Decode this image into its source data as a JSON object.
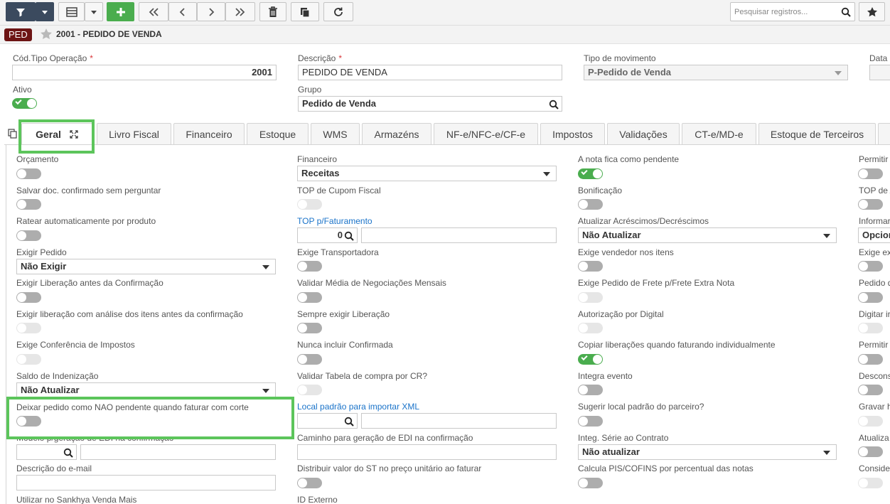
{
  "toolbar": {
    "search_placeholder": "Pesquisar registros..."
  },
  "header": {
    "badge": "PED",
    "title": "2001 - PEDIDO DE VENDA"
  },
  "form": {
    "cod_tipo_label": "Cód.Tipo Operação",
    "cod_tipo_value": "2001",
    "descricao_label": "Descrição",
    "descricao_value": "PEDIDO DE VENDA",
    "tipo_mov_label": "Tipo de movimento",
    "tipo_mov_value": "P-Pedido de Venda",
    "data_label": "Data",
    "ativo_label": "Ativo",
    "grupo_label": "Grupo",
    "grupo_value": "Pedido de Venda",
    "required_mark": "*"
  },
  "tabs": [
    "Geral",
    "Livro Fiscal",
    "Financeiro",
    "Estoque",
    "WMS",
    "Armazéns",
    "NF-e/NFC-e/CF-e",
    "Impostos",
    "Validações",
    "CT-e/MD-e",
    "Estoque de Terceiros"
  ],
  "col1": {
    "orcamento": "Orçamento",
    "salvar": "Salvar doc. confirmado sem perguntar",
    "ratear": "Ratear automaticamente por produto",
    "exigir_pedido": "Exigir Pedido",
    "exigir_pedido_value": "Não Exigir",
    "exigir_lib": "Exigir Liberação antes da Confirmação",
    "exigir_lib_analise": "Exigir liberação com análise dos itens antes da confirmação",
    "exige_conf": "Exige Conferência de Impostos",
    "saldo": "Saldo de Indenização",
    "saldo_value": "Não Atualizar",
    "deixar": "Deixar pedido como NAO pendente quando faturar com corte",
    "modelo": "Modelo p/geração de EDI na confirmação",
    "desc_email": "Descrição do e-mail",
    "utilizar": "Utilizar no Sankhya Venda Mais"
  },
  "col2": {
    "financeiro": "Financeiro",
    "financeiro_value": "Receitas",
    "top_cupom": "TOP de Cupom Fiscal",
    "top_fat": "TOP p/Faturamento",
    "top_fat_value": "0",
    "exige_transp": "Exige Transportadora",
    "validar_media": "Validar Média de Negociações Mensais",
    "sempre_exigir": "Sempre exigir Liberação",
    "nunca_incluir": "Nunca incluir Confirmada",
    "validar_tabela": "Validar Tabela de compra por CR?",
    "local_padrao": "Local padrão para importar XML",
    "caminho": "Caminho para geração de EDI na confirmação",
    "distribuir": "Distribuir valor do ST no preço unitário ao faturar",
    "id_externo": "ID Externo"
  },
  "col3": {
    "nota_pendente": "A nota fica como pendente",
    "bonificacao": "Bonificação",
    "atualizar_acresc": "Atualizar Acréscimos/Decréscimos",
    "atualizar_acresc_value": "Não Atualizar",
    "exige_vendedor": "Exige vendedor nos itens",
    "exige_frete": "Exige Pedido de Frete p/Frete Extra Nota",
    "autorizacao": "Autorização por Digital",
    "copiar": "Copiar liberações quando faturando individualmente",
    "integra": "Integra evento",
    "sugerir": "Sugerir local padrão do parceiro?",
    "integ_serie": "Integ. Série ao Contrato",
    "integ_serie_value": "Não atualizar",
    "calcula": "Calcula PIS/COFINS por percentual das notas"
  },
  "col4": {
    "permitir1": "Permitir",
    "top_de": "TOP de A",
    "informar": "Informar",
    "opcion": "Opcion",
    "exige_ex": "Exige ex",
    "pedido_d": "Pedido d",
    "digitar": "Digitar ir",
    "permitir2": "Permitir",
    "descons": "Descons",
    "gravar": "Gravar h",
    "atualiza": "Atualiza",
    "conside": "Conside"
  },
  "colors": {
    "accent_green": "#4aad4e",
    "badge": "#6d1414",
    "highlight": "#5cc55b",
    "toolbar_dark": "#3b4a5e"
  }
}
